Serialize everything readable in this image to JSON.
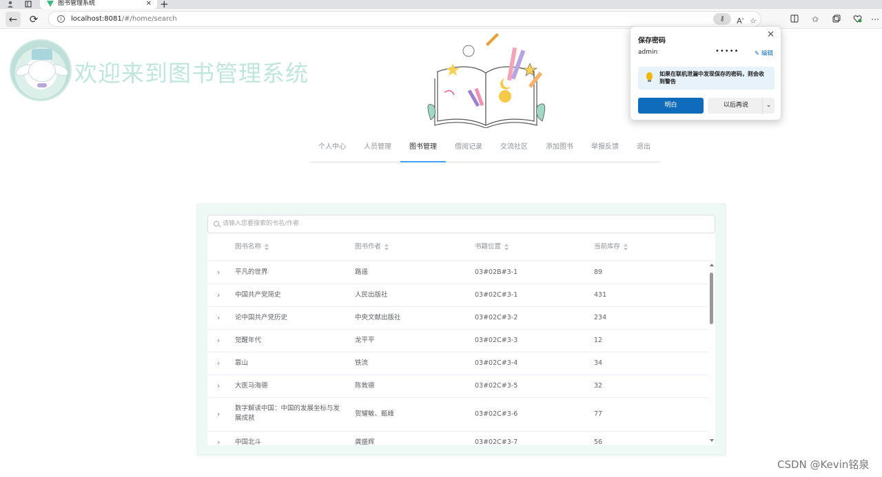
{
  "browser": {
    "tab_title": "图书管理系统",
    "tab_close": "✕",
    "new_tab": "+",
    "back": "←",
    "reload": "⟳",
    "url_host": "localhost:8081",
    "url_path": "/#/home/search",
    "read_aloud": "Aʾ"
  },
  "header": {
    "site_title": "欢迎来到图书管理系统"
  },
  "nav": {
    "items": [
      {
        "label": "个人中心"
      },
      {
        "label": "人员管理"
      },
      {
        "label": "图书管理",
        "active": true
      },
      {
        "label": "借阅记录"
      },
      {
        "label": "交流社区"
      },
      {
        "label": "添加图书"
      },
      {
        "label": "举报反馈"
      },
      {
        "label": "退出"
      }
    ]
  },
  "password_popup": {
    "title": "保存密码",
    "close": "✕",
    "username": "admin",
    "password_mask": "•••••",
    "edit_label": "✎ 编辑",
    "warning": "如果在联机泄漏中发现保存的密码，则会收到警告",
    "ok_button": "明白",
    "later_button": "以后再说",
    "dropdown": "⌄"
  },
  "search": {
    "placeholder": "请输入您要搜索的书名/作者"
  },
  "table": {
    "columns": [
      "图书名称",
      "图书作者",
      "书籍位置",
      "当前库存"
    ],
    "rows": [
      {
        "name": "平凡的世界",
        "author": "路遥",
        "location": "03#02B#3-1",
        "stock": "89"
      },
      {
        "name": "中国共产党简史",
        "author": "人民出版社",
        "location": "03#02C#3-1",
        "stock": "431"
      },
      {
        "name": "论中国共产党历史",
        "author": "中央文献出版社",
        "location": "03#02C#3-2",
        "stock": "234"
      },
      {
        "name": "觉醒年代",
        "author": "龙平平",
        "location": "03#02C#3-3",
        "stock": "12"
      },
      {
        "name": "靠山",
        "author": "铁流",
        "location": "03#02C#3-4",
        "stock": "34"
      },
      {
        "name": "大医马海德",
        "author": "陈敦德",
        "location": "03#02C#3-5",
        "stock": "32"
      },
      {
        "name": "数字解读中国：中国的发展坐标与发展成就",
        "author": "贺耀敏、甄峰",
        "location": "03#02C#3-6",
        "stock": "77"
      },
      {
        "name": "中国北斗",
        "author": "龚盛辉",
        "location": "03#02C#3-7",
        "stock": "56"
      }
    ]
  },
  "watermark": "CSDN @Kevin铭泉",
  "colors": {
    "accent": "#409eff",
    "title_mint": "#bfe6dc",
    "card_bg": "#eef9f6",
    "edge_blue": "#0f6cbd"
  }
}
